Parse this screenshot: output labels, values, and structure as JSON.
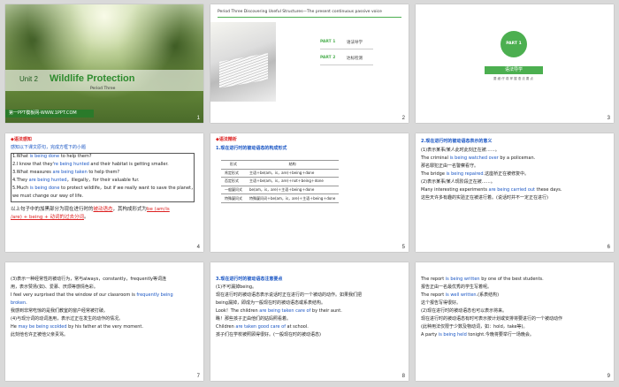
{
  "slides": [
    {
      "num": "1",
      "unit": "Unit 2",
      "title": "Wildlife Protection",
      "period": "Period Three",
      "footer": "第一PPT模板网-WWW.1PPT.COM"
    },
    {
      "num": "2",
      "header": "Period Three    Discovering Useful Structures—The present continuous passive voice",
      "parts": [
        {
          "label": "PART 1",
          "text": "语法导学"
        },
        {
          "label": "PART 2",
          "text": "达标检测"
        }
      ]
    },
    {
      "num": "3",
      "circle": "PART 1",
      "bar": "语法导学",
      "sub": "要 细 仔 观    掌 握 语 法 要 点"
    },
    {
      "num": "4",
      "heading": "◆语法感知",
      "intro": "感知以下课文原句，完成方框下的小题",
      "lines": [
        {
          "pre": "1.What ",
          "hl": "is being done",
          "post": " to help them?"
        },
        {
          "pre": "2.I know that they'",
          "hl": "re being hunted",
          "post": " and their habitat is getting smaller."
        },
        {
          "pre": "3.What measures ",
          "hl": "are being taken",
          "post": " to help them?"
        },
        {
          "pre": "4.They ",
          "hl": "are being hunted",
          "post": "，illegally，for their valuable fur."
        },
        {
          "pre": "5.Much ",
          "hl": "is being done",
          "post": " to protect wildlife，but if we really want to save the planet，"
        },
        {
          "pre": "we must change our way of life.",
          "hl": "",
          "post": ""
        }
      ],
      "summary": {
        "pre": "以上句子中的加黑部分为现在进行时的",
        "red1": "被动语态",
        "mid": "，其构成形式为",
        "red2": "be (am/is",
        "line2": "/are) + being + 动词的过去分词",
        "end": "。"
      }
    },
    {
      "num": "5",
      "heading": "◆语法精析",
      "sub": "1.现在进行时的被动语态的构成形式",
      "table": {
        "headers": [
          "形式",
          "结构"
        ],
        "rows": [
          [
            "肯定形式",
            "主语＋be(am，is，are)＋being＋done"
          ],
          [
            "否定形式",
            "主语＋be(am，is，are)＋not＋being＋done"
          ],
          [
            "一般疑问式",
            "be(am，is，are)＋主语＋being＋done"
          ],
          [
            "特殊疑问式",
            "特殊疑问词＋be(am，is，are)＋主语＋being＋done"
          ]
        ]
      }
    },
    {
      "num": "6",
      "heading": "2.现在进行时的被动语态表示的意义",
      "lines": [
        {
          "pre": "(1)表示某事/某人此时此刻正在被……。",
          "hl": "",
          "post": ""
        },
        {
          "pre": "The criminal ",
          "hl": "is being watched over",
          "post": " by a policeman."
        },
        {
          "pre": "那名罪犯正由一名警察看守。",
          "hl": "",
          "post": ""
        },
        {
          "pre": "The bridge ",
          "hl": "is being repaired",
          "post": ".这座桥正在被修复中。"
        },
        {
          "pre": "(2)表示某事/某人现阶段正在被……。",
          "hl": "",
          "post": ""
        },
        {
          "pre": "Many interesting experiments ",
          "hl": "are being carried out",
          "post": " these days."
        },
        {
          "pre": "这些天许多有趣的实验正在被进行着。(说话时并不一定正在进行)",
          "hl": "",
          "post": ""
        }
      ]
    },
    {
      "num": "7",
      "lines": [
        {
          "pre": "(3)表示一种经常性的被动行为，常与always，constantly，frequently等词连",
          "hl": "",
          "post": ""
        },
        {
          "pre": "用，表示赞扬(如)、爱慕、厌烦等感情色彩。",
          "hl": "",
          "post": ""
        },
        {
          "pre": "I feel very surprised that the window of our classroom is ",
          "hl": "frequently being",
          "post": ""
        },
        {
          "pre": "",
          "hl": "broken",
          "post": "."
        },
        {
          "pre": "我感到非常吃惊的是我们教室的窗户经常被打破。",
          "hl": "",
          "post": ""
        },
        {
          "pre": "(4)与现分词的动词连用，表示过正在发生的动作的情况。",
          "hl": "",
          "post": ""
        },
        {
          "pre": "He ",
          "hl": "may be being scolded",
          "post": " by his father at the very moment."
        },
        {
          "pre": "此刻他也许正被他父亲责骂。",
          "hl": "",
          "post": ""
        }
      ]
    },
    {
      "num": "8",
      "heading": "3.现在进行时的被动语态注意要点",
      "lines": [
        {
          "pre": "(1)不可漏掉being。",
          "hl": "",
          "post": ""
        },
        {
          "pre": "现在进行时的被动语态表示说话时正在进行的一个被动的动作。如果我们把",
          "hl": "",
          "post": ""
        },
        {
          "pre": "being漏掉，即成为一般现在时的被动语态或系表结构。",
          "hl": "",
          "post": ""
        },
        {
          "pre": "Look！The children ",
          "hl": "are being taken care of",
          "post": " by their aunt."
        },
        {
          "pre": "瞧！那些孩子正由他们的姑妈照看着。",
          "hl": "",
          "post": ""
        },
        {
          "pre": "Children ",
          "hl": "are taken good care of",
          "post": " at school."
        },
        {
          "pre": "孩子们在学校被照顾得很好。(一般现在时的被动语态)",
          "hl": "",
          "post": ""
        }
      ]
    },
    {
      "num": "9",
      "lines": [
        {
          "pre": "The report ",
          "hl": "is being written",
          "post": " by one of the best students."
        },
        {
          "pre": "报告正由一名最优秀的学生写着呢。",
          "hl": "",
          "post": ""
        },
        {
          "pre": "The report ",
          "hl": "is well written",
          "post": ".(系表结构)"
        },
        {
          "pre": "这个报告写得很好。",
          "hl": "",
          "post": ""
        },
        {
          "pre": "(2)现在进行时的被动语态也可以表示将来。",
          "hl": "",
          "post": ""
        },
        {
          "pre": "现在进行时的被动语态有时可表示按计划或安排将要进行的一个被动动作",
          "hl": "",
          "post": ""
        },
        {
          "pre": "(此种用法仅限于少数及物动词，如：hold，take等)。",
          "hl": "",
          "post": ""
        },
        {
          "pre": "A party ",
          "hl": "is being held",
          "post": " tonight.今晚将要举行一场晚会。"
        }
      ]
    }
  ]
}
